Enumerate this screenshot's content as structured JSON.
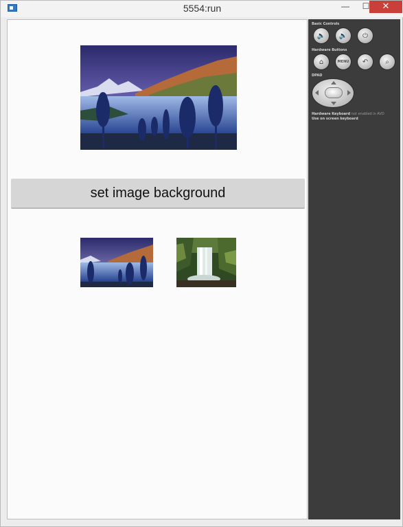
{
  "window": {
    "title": "5554:run",
    "controls": {
      "minimize_symbol": "—",
      "maximize_symbol": "☐",
      "close_symbol": "✕"
    },
    "close_color": "#c9403a"
  },
  "app": {
    "main_image": {
      "icon": "mountain-lake-landscape-image"
    },
    "set_background_button_label": "set image background",
    "thumbnails": [
      {
        "icon": "mountain-lake-landscape-image"
      },
      {
        "icon": "waterfall-forest-image"
      }
    ]
  },
  "emulator_controls": {
    "basic_controls_label": "Basic Controls",
    "basic_buttons": [
      {
        "icon": "volume-down-icon",
        "symbol": "🔈"
      },
      {
        "icon": "volume-up-icon",
        "symbol": "🔊"
      },
      {
        "icon": "power-icon",
        "symbol": "⏻"
      }
    ],
    "hardware_buttons_label": "Hardware Buttons",
    "hardware_buttons": [
      {
        "icon": "home-icon",
        "symbol": "⌂"
      },
      {
        "icon": "menu-icon",
        "label": "MENU"
      },
      {
        "icon": "back-icon",
        "symbol": "↶"
      },
      {
        "icon": "search-icon",
        "symbol": "⌕"
      }
    ],
    "dpad_label": "DPAD",
    "keyboard_note_bold": "Hardware Keyboard",
    "keyboard_note_dim": " not enabled in AVD",
    "keyboard_note_line2": "Use on screen keyboard"
  },
  "colors": {
    "controls_panel": "#3c3c3c",
    "button_bg": "#d6d6d6",
    "screen_bg": "#fbfbfb"
  }
}
